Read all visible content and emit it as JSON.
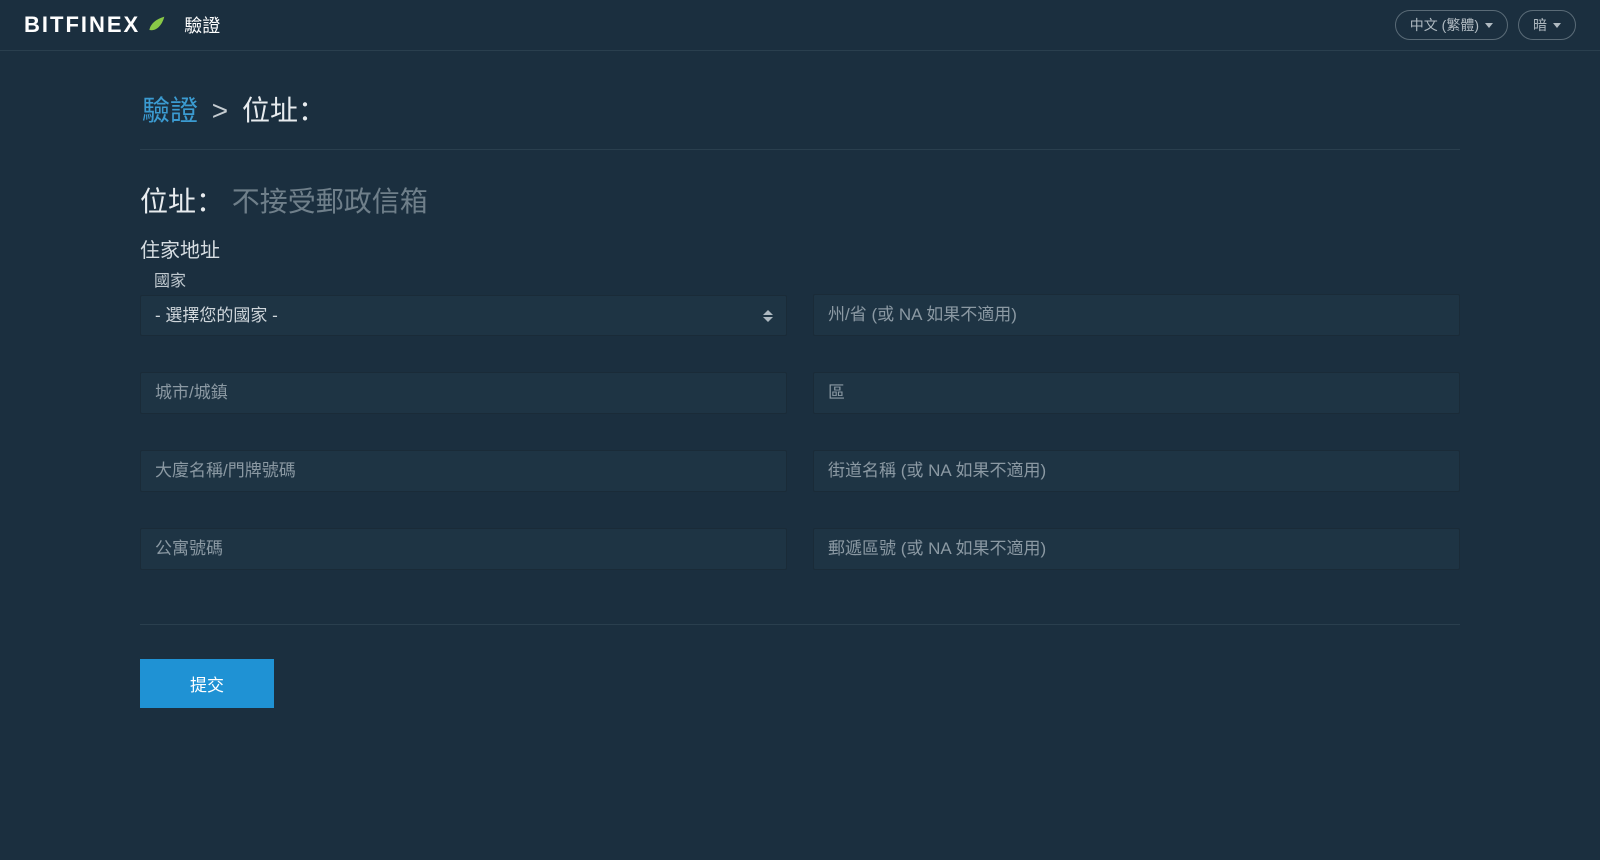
{
  "header": {
    "brand": "BITFINEX",
    "subtitle": "驗證",
    "language_label": "中文 (繁體)",
    "theme_label": "暗"
  },
  "breadcrumb": {
    "link": "驗證",
    "sep": ">",
    "current": "位址："
  },
  "section": {
    "title": "位址：",
    "note": "不接受郵政信箱",
    "group_label": "住家地址",
    "country_label": "國家",
    "country_option": "- 選擇您的國家 -",
    "state_placeholder": "州/省 (或 NA 如果不適用)",
    "city_placeholder": "城市/城鎮",
    "district_placeholder": "區",
    "building_placeholder": "大廈名稱/門牌號碼",
    "street_placeholder": "街道名稱 (或 NA 如果不適用)",
    "apt_placeholder": "公寓號碼",
    "postal_placeholder": "郵遞區號 (或 NA 如果不適用)"
  },
  "actions": {
    "submit": "提交"
  }
}
